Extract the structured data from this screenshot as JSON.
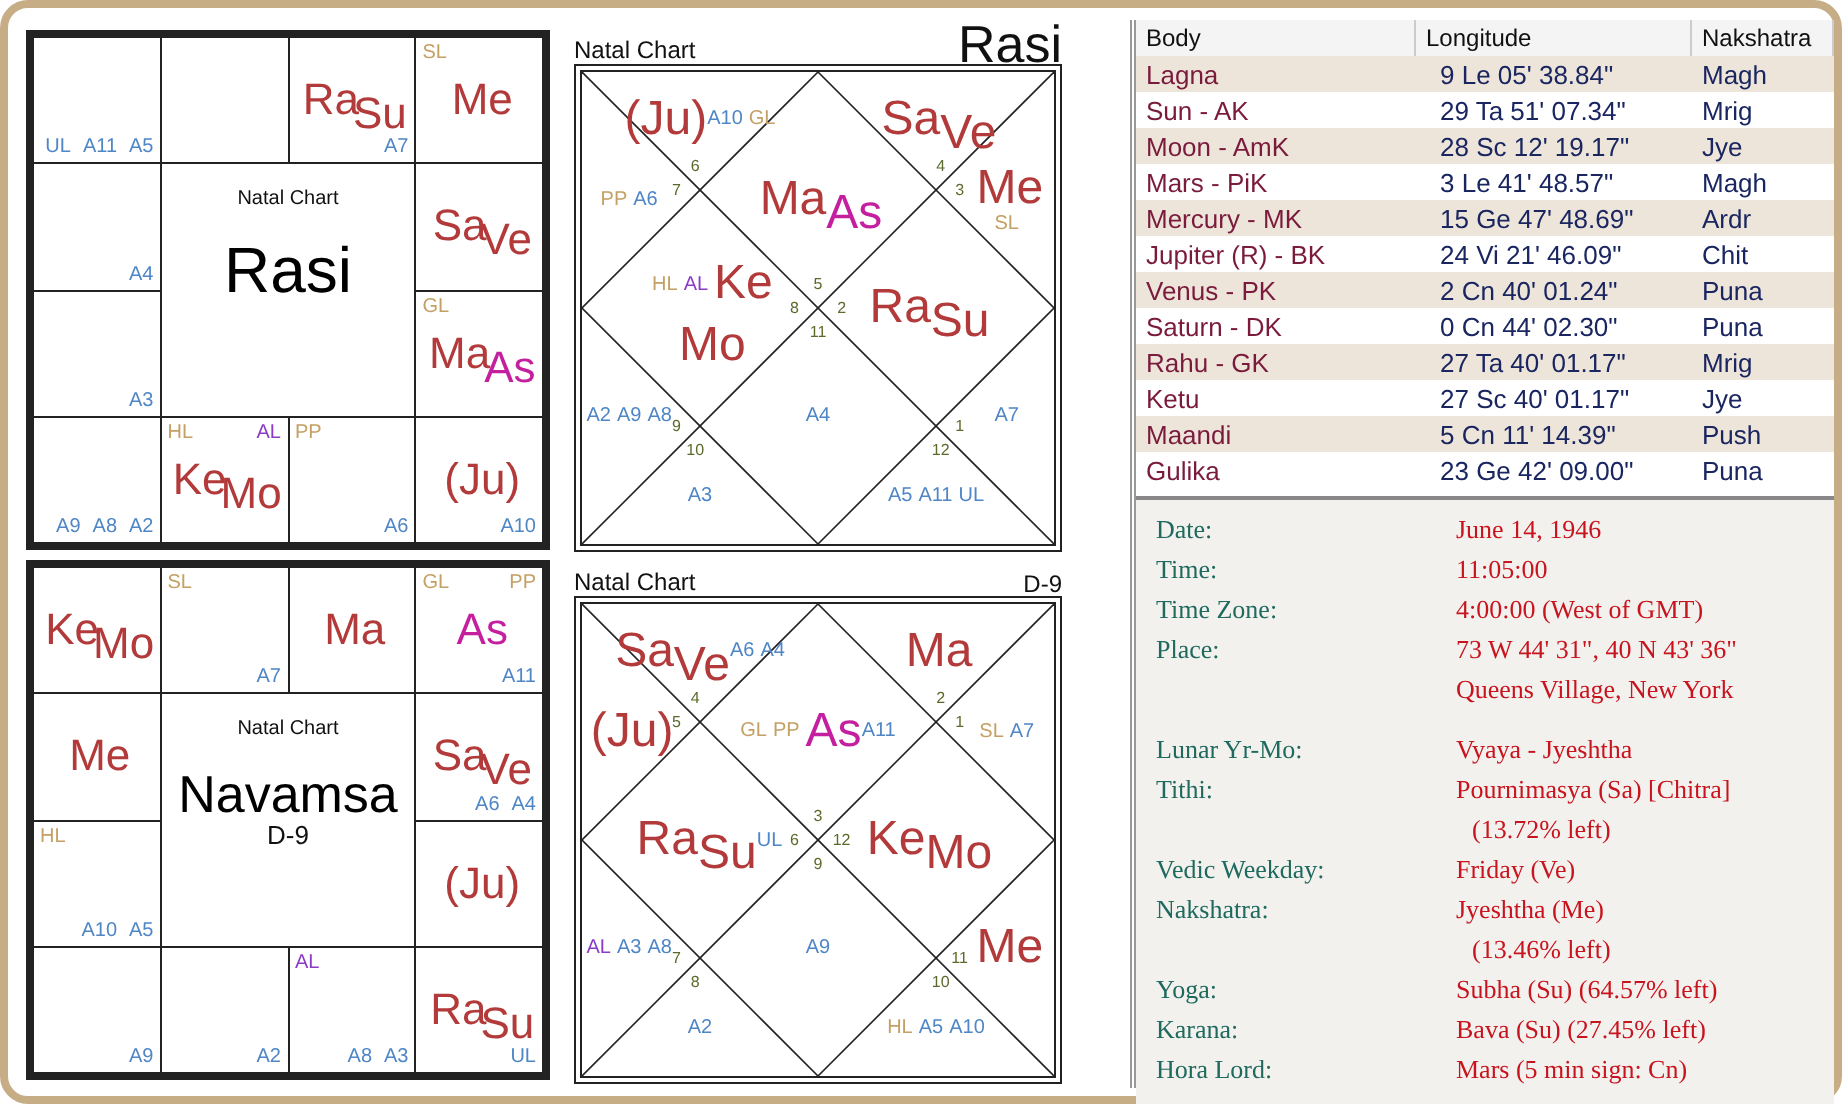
{
  "south_charts": [
    {
      "caption": "Natal Chart",
      "title": "Rasi",
      "cells": [
        {
          "items": [
            {
              "text": "UL",
              "kind": "arudha"
            },
            {
              "text": "A11",
              "kind": "arudha"
            },
            {
              "text": "A5",
              "kind": "arudha"
            }
          ]
        },
        {},
        {
          "items": [
            {
              "text": "Ra",
              "kind": "planet"
            },
            {
              "text": "Su",
              "kind": "planet"
            },
            {
              "text": "A7",
              "kind": "arudha"
            }
          ]
        },
        {
          "items": [
            {
              "text": "SL",
              "kind": "special"
            },
            {
              "text": "Me",
              "kind": "planet"
            }
          ]
        },
        {
          "items": [
            {
              "text": "A4",
              "kind": "arudha"
            }
          ]
        },
        {
          "items": [
            {
              "text": "Sa",
              "kind": "planet"
            },
            {
              "text": "Ve",
              "kind": "planet"
            }
          ]
        },
        {
          "items": [
            {
              "text": "A3",
              "kind": "arudha"
            }
          ]
        },
        {
          "items": [
            {
              "text": "GL",
              "kind": "special"
            },
            {
              "text": "Ma",
              "kind": "planet"
            },
            {
              "text": "As",
              "kind": "lagna"
            }
          ]
        },
        {
          "items": [
            {
              "text": "A9",
              "kind": "arudha"
            },
            {
              "text": "A8",
              "kind": "arudha"
            },
            {
              "text": "A2",
              "kind": "arudha"
            }
          ]
        },
        {
          "items": [
            {
              "text": "HL",
              "kind": "special"
            },
            {
              "text": "AL",
              "kind": "al"
            },
            {
              "text": "Ke",
              "kind": "planet"
            },
            {
              "text": "Mo",
              "kind": "planet"
            }
          ]
        },
        {
          "items": [
            {
              "text": "PP",
              "kind": "special"
            },
            {
              "text": "A6",
              "kind": "arudha"
            }
          ]
        },
        {
          "items": [
            {
              "text": "(Ju)",
              "kind": "planet"
            },
            {
              "text": "A10",
              "kind": "arudha"
            }
          ]
        }
      ]
    },
    {
      "caption": "Natal Chart",
      "title": "Navamsa",
      "subtitle": "D-9",
      "cells": [
        {
          "items": [
            {
              "text": "Ke",
              "kind": "planet"
            },
            {
              "text": "Mo",
              "kind": "planet"
            }
          ]
        },
        {
          "items": [
            {
              "text": "SL",
              "kind": "special"
            },
            {
              "text": "A7",
              "kind": "arudha"
            }
          ]
        },
        {
          "items": [
            {
              "text": "Ma",
              "kind": "planet"
            }
          ]
        },
        {
          "items": [
            {
              "text": "GL",
              "kind": "special"
            },
            {
              "text": "PP",
              "kind": "special"
            },
            {
              "text": "As",
              "kind": "lagna"
            },
            {
              "text": "A11",
              "kind": "arudha"
            }
          ]
        },
        {
          "items": [
            {
              "text": "Me",
              "kind": "planet"
            }
          ]
        },
        {
          "items": [
            {
              "text": "Sa",
              "kind": "planet"
            },
            {
              "text": "Ve",
              "kind": "planet"
            },
            {
              "text": "A6",
              "kind": "arudha"
            },
            {
              "text": "A4",
              "kind": "arudha"
            }
          ]
        },
        {
          "items": [
            {
              "text": "HL",
              "kind": "special"
            },
            {
              "text": "A10",
              "kind": "arudha"
            },
            {
              "text": "A5",
              "kind": "arudha"
            }
          ]
        },
        {
          "items": [
            {
              "text": "(Ju)",
              "kind": "planet"
            }
          ]
        },
        {
          "items": [
            {
              "text": "A9",
              "kind": "arudha"
            }
          ]
        },
        {
          "items": [
            {
              "text": "A2",
              "kind": "arudha"
            }
          ]
        },
        {
          "items": [
            {
              "text": "AL",
              "kind": "al"
            },
            {
              "text": "A8",
              "kind": "arudha"
            },
            {
              "text": "A3",
              "kind": "arudha"
            }
          ]
        },
        {
          "items": [
            {
              "text": "Ra",
              "kind": "planet"
            },
            {
              "text": "Su",
              "kind": "planet"
            },
            {
              "text": "UL",
              "kind": "arudha"
            }
          ]
        }
      ]
    }
  ],
  "north_charts": [
    {
      "caption": "Natal Chart",
      "title": "Rasi",
      "houses": [
        {
          "number": "5",
          "items": [
            {
              "text": "Ma",
              "kind": "planet"
            },
            {
              "text": "As",
              "kind": "lagna"
            }
          ]
        },
        {
          "number": "6",
          "items": [
            {
              "text": "(Ju)",
              "kind": "planet"
            },
            {
              "text": "A10",
              "kind": "arudha"
            },
            {
              "text": "GL",
              "kind": "special"
            }
          ]
        },
        {
          "number": "7",
          "items": [
            {
              "text": "PP",
              "kind": "special"
            },
            {
              "text": "A6",
              "kind": "arudha"
            }
          ]
        },
        {
          "number": "8",
          "items": [
            {
              "text": "HL",
              "kind": "special"
            },
            {
              "text": "AL",
              "kind": "al"
            },
            {
              "text": "Ke",
              "kind": "planet"
            },
            {
              "text": "Mo",
              "kind": "planet"
            }
          ]
        },
        {
          "number": "9",
          "items": [
            {
              "text": "A2",
              "kind": "arudha"
            },
            {
              "text": "A9",
              "kind": "arudha"
            },
            {
              "text": "A8",
              "kind": "arudha"
            }
          ]
        },
        {
          "number": "10",
          "items": [
            {
              "text": "A3",
              "kind": "arudha"
            }
          ]
        },
        {
          "number": "11",
          "items": [
            {
              "text": "A4",
              "kind": "arudha"
            }
          ]
        },
        {
          "number": "12",
          "items": [
            {
              "text": "A5",
              "kind": "arudha"
            },
            {
              "text": "A11",
              "kind": "arudha"
            },
            {
              "text": "UL",
              "kind": "arudha"
            }
          ]
        },
        {
          "number": "1",
          "items": [
            {
              "text": "A7",
              "kind": "arudha"
            }
          ]
        },
        {
          "number": "2",
          "items": [
            {
              "text": "Ra",
              "kind": "planet"
            },
            {
              "text": "Su",
              "kind": "planet"
            }
          ]
        },
        {
          "number": "3",
          "items": [
            {
              "text": "Me",
              "kind": "planet"
            },
            {
              "text": "SL",
              "kind": "special"
            }
          ]
        },
        {
          "number": "4",
          "items": [
            {
              "text": "Sa",
              "kind": "planet"
            },
            {
              "text": "Ve",
              "kind": "planet"
            }
          ]
        }
      ]
    },
    {
      "caption": "Natal Chart",
      "title": "D-9",
      "houses": [
        {
          "number": "3",
          "items": [
            {
              "text": "GL",
              "kind": "special"
            },
            {
              "text": "PP",
              "kind": "special"
            },
            {
              "text": "As",
              "kind": "lagna"
            },
            {
              "text": "A11",
              "kind": "arudha"
            }
          ]
        },
        {
          "number": "4",
          "items": [
            {
              "text": "Sa",
              "kind": "planet"
            },
            {
              "text": "Ve",
              "kind": "planet"
            },
            {
              "text": "A6",
              "kind": "arudha"
            },
            {
              "text": "A4",
              "kind": "arudha"
            }
          ]
        },
        {
          "number": "5",
          "items": [
            {
              "text": "(Ju)",
              "kind": "planet"
            }
          ]
        },
        {
          "number": "6",
          "items": [
            {
              "text": "Ra",
              "kind": "planet"
            },
            {
              "text": "Su",
              "kind": "planet"
            },
            {
              "text": "UL",
              "kind": "arudha"
            }
          ]
        },
        {
          "number": "7",
          "items": [
            {
              "text": "AL",
              "kind": "al"
            },
            {
              "text": "A3",
              "kind": "arudha"
            },
            {
              "text": "A8",
              "kind": "arudha"
            }
          ]
        },
        {
          "number": "8",
          "items": [
            {
              "text": "A2",
              "kind": "arudha"
            }
          ]
        },
        {
          "number": "9",
          "items": [
            {
              "text": "A9",
              "kind": "arudha"
            }
          ]
        },
        {
          "number": "10",
          "items": [
            {
              "text": "HL",
              "kind": "special"
            },
            {
              "text": "A5",
              "kind": "arudha"
            },
            {
              "text": "A10",
              "kind": "arudha"
            }
          ]
        },
        {
          "number": "11",
          "items": [
            {
              "text": "Me",
              "kind": "planet"
            }
          ]
        },
        {
          "number": "12",
          "items": [
            {
              "text": "Ke",
              "kind": "planet"
            },
            {
              "text": "Mo",
              "kind": "planet"
            }
          ]
        },
        {
          "number": "1",
          "items": [
            {
              "text": "SL",
              "kind": "special"
            },
            {
              "text": "A7",
              "kind": "arudha"
            }
          ]
        },
        {
          "number": "2",
          "items": [
            {
              "text": "Ma",
              "kind": "planet"
            }
          ]
        }
      ]
    }
  ],
  "table": {
    "columns": [
      "Body",
      "Longitude",
      "Nakshatra"
    ],
    "rows": [
      [
        "Lagna",
        "9 Le 05' 38.84\"",
        "Magh"
      ],
      [
        "Sun - AK",
        "29 Ta 51' 07.34\"",
        "Mrig"
      ],
      [
        "Moon - AmK",
        "28 Sc 12' 19.17\"",
        "Jye"
      ],
      [
        "Mars - PiK",
        "3 Le 41' 48.57\"",
        "Magh"
      ],
      [
        "Mercury - MK",
        "15 Ge 47' 48.69\"",
        "Ardr"
      ],
      [
        "Jupiter (R) - BK",
        "24 Vi 21' 46.09\"",
        "Chit"
      ],
      [
        "Venus - PK",
        "2 Cn 40' 01.24\"",
        "Puna"
      ],
      [
        "Saturn - DK",
        "0 Cn 44' 02.30\"",
        "Puna"
      ],
      [
        "Rahu - GK",
        "27 Ta 40' 01.17\"",
        "Mrig"
      ],
      [
        "Ketu",
        "27 Sc 40' 01.17\"",
        "Jye"
      ],
      [
        "Maandi",
        "5 Cn 11' 14.39\"",
        "Push"
      ],
      [
        "Gulika",
        "23 Ge 42' 09.00\"",
        "Puna"
      ]
    ]
  },
  "details": [
    [
      {
        "label": "Date:",
        "values": [
          "June 14, 1946"
        ]
      },
      {
        "label": "Time:",
        "values": [
          "11:05:00"
        ]
      },
      {
        "label": "Time Zone:",
        "values": [
          "4:00:00 (West of GMT)"
        ]
      },
      {
        "label": "Place:",
        "values": [
          "73 W 44' 31\", 40 N 43' 36\"",
          "Queens Village, New York"
        ]
      }
    ],
    [
      {
        "label": "Lunar Yr-Mo:",
        "values": [
          "Vyaya - Jyeshtha"
        ]
      },
      {
        "label": "Tithi:",
        "values": [
          "Pournimasya (Sa) [Chitra]",
          "(13.72% left)"
        ]
      },
      {
        "label": "Vedic Weekday:",
        "values": [
          "Friday (Ve)"
        ]
      },
      {
        "label": "Nakshatra:",
        "values": [
          "Jyeshtha (Me)",
          "(13.46% left)"
        ]
      },
      {
        "label": "Yoga:",
        "values": [
          "Subha (Su) (64.57% left)"
        ]
      },
      {
        "label": "Karana:",
        "values": [
          "Bava (Su) (27.45% left)"
        ]
      },
      {
        "label": "Hora Lord:",
        "values": [
          "Mars (5 min sign: Cn)"
        ]
      }
    ]
  ]
}
